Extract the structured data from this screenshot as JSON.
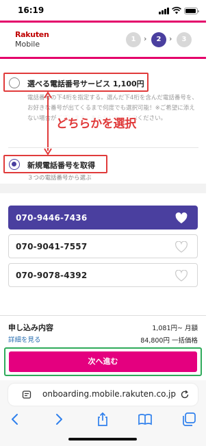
{
  "status_bar": {
    "time": "16:19"
  },
  "header": {
    "logo_line1": "Rakuten",
    "logo_line2": "Mobile",
    "steps": [
      {
        "label": "1",
        "active": false
      },
      {
        "label": "2",
        "active": true
      },
      {
        "label": "3",
        "active": false
      }
    ],
    "step_separator": "›"
  },
  "options": {
    "choose_number": {
      "label": "選べる電話番号サービス 1,100円",
      "selected": false,
      "description": "電話番号の下4桁を指定する。選んだ下4桁を含んだ電話番号を、お好きな番号が出てくるまで何度でも選択可能！※ご希望に添えない場合がございます。あらかじめご了承ください。"
    },
    "new_number": {
      "label": "新規電話番号を取得",
      "selected": true,
      "note": "３つの電話番号から選ぶ"
    }
  },
  "annotation": "どちらかを選択",
  "numbers": [
    {
      "number": "070-9446-7436",
      "selected": true
    },
    {
      "number": "070-9041-7557",
      "selected": false
    },
    {
      "number": "070-9078-4392",
      "selected": false
    }
  ],
  "summary": {
    "title": "申し込み内容",
    "details_link": "詳細を見る",
    "monthly": "1,081円~ 月額",
    "one_time": "84,800円 一括価格",
    "next_button": "次へ進む"
  },
  "browser": {
    "url": "onboarding.mobile.rakuten.co.jp"
  },
  "colors": {
    "brand_pink": "#e4006a",
    "accent_purple": "#4a3f9f",
    "button_magenta": "#e4007f",
    "annotation_red": "#e03a3a",
    "highlight_green": "#2eaa5a",
    "link_blue": "#2a6fb0"
  },
  "icons": {
    "status": [
      "signal-icon",
      "wifi-icon",
      "battery-icon"
    ],
    "card": "heart-icon",
    "url_bar": [
      "page-format-icon",
      "reload-icon"
    ],
    "toolbar": [
      "back-icon",
      "forward-icon",
      "share-icon",
      "bookmarks-icon",
      "tabs-icon"
    ]
  }
}
